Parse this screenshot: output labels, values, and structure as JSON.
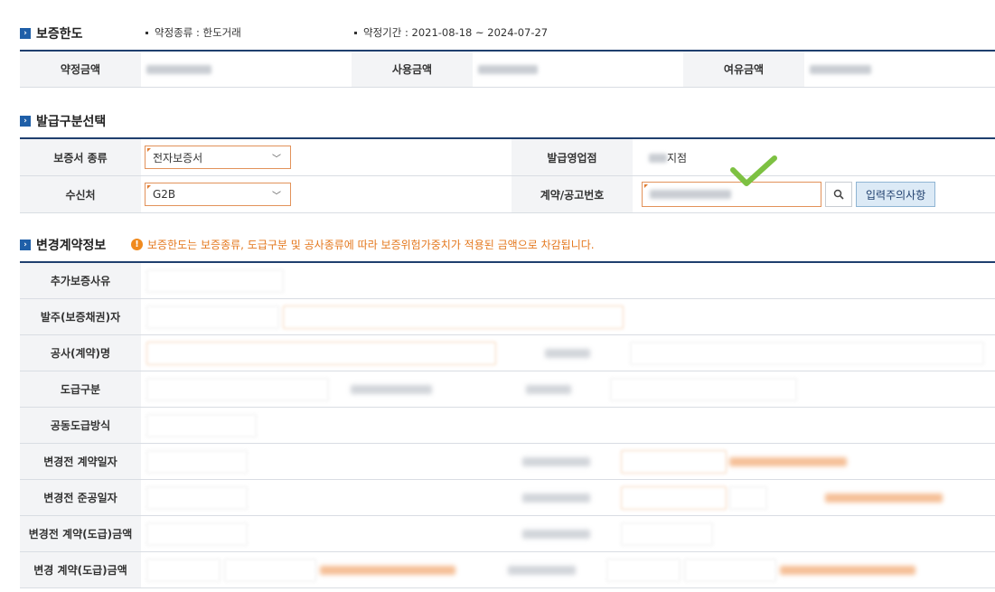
{
  "section_limit": {
    "title": "보증한도",
    "meta_type": "약정종류 : 한도거래",
    "meta_period": "약정기간 : 2021-08-18 ~ 2024-07-27",
    "labels": {
      "contract_amount": "약정금액",
      "used_amount": "사용금액",
      "spare_amount": "여유금액"
    }
  },
  "section_issue": {
    "title": "발급구분선택",
    "labels": {
      "guarantee_type": "보증서 종류",
      "issue_branch": "발급영업점",
      "recipient": "수신처",
      "contract_no": "계약/공고번호"
    },
    "guarantee_type_value": "전자보증서",
    "recipient_value": "G2B",
    "branch_suffix": "지점",
    "notice_button": "입력주의사항"
  },
  "section_change": {
    "title": "변경계약정보",
    "warning": "보증한도는 보증종류, 도급구분 및 공사종류에 따라 보증위험가중치가 적용된 금액으로 차감됩니다.",
    "rows": [
      "추가보증사유",
      "발주(보증채권)자",
      "공사(계약)명",
      "도급구분",
      "공동도급방식",
      "변경전 계약일자",
      "변경전 준공일자",
      "변경전 계약(도급)금액",
      "변경 계약(도급)금액"
    ]
  },
  "icons": {
    "section": "section-arrow-icon",
    "search": "search-icon",
    "check": "check-mark-icon",
    "warning": "warning-icon"
  },
  "colors": {
    "accent_orange": "#e4781e",
    "header_navy": "#1f3f6e",
    "check_green": "#7dc142"
  }
}
